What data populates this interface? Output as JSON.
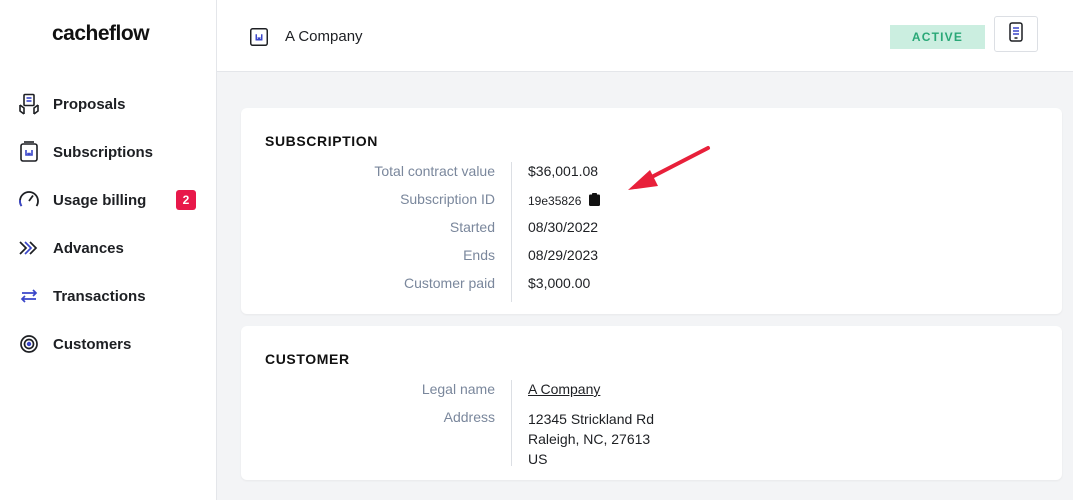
{
  "app": {
    "logo": "cacheflow"
  },
  "sidebar": {
    "items": [
      {
        "label": "Proposals",
        "icon": "proposals-icon"
      },
      {
        "label": "Subscriptions",
        "icon": "subscriptions-icon"
      },
      {
        "label": "Usage billing",
        "icon": "gauge-icon",
        "badge": "2"
      },
      {
        "label": "Advances",
        "icon": "double-chevron-icon"
      },
      {
        "label": "Transactions",
        "icon": "transfer-arrows-icon"
      },
      {
        "label": "Customers",
        "icon": "target-icon"
      }
    ]
  },
  "header": {
    "title": "A Company",
    "status": "ACTIVE"
  },
  "subscription": {
    "title": "SUBSCRIPTION",
    "rows": [
      {
        "label": "Total contract value",
        "value": "$36,001.08"
      },
      {
        "label": "Subscription ID",
        "value": "19e35826"
      },
      {
        "label": "Started",
        "value": "08/30/2022"
      },
      {
        "label": "Ends",
        "value": "08/29/2023"
      },
      {
        "label": "Customer paid",
        "value": "$3,000.00"
      }
    ]
  },
  "customer": {
    "title": "CUSTOMER",
    "legal_name_label": "Legal name",
    "legal_name": "A Company",
    "address_label": "Address",
    "address_lines": [
      "12345 Strickland Rd",
      "Raleigh, NC, 27613",
      "US"
    ]
  },
  "colors": {
    "accent": "#3a46c9",
    "badge_red": "#e8184a",
    "status_bg": "#cbeee0",
    "status_text": "#2aa877",
    "annotation_arrow": "#e8203a"
  }
}
